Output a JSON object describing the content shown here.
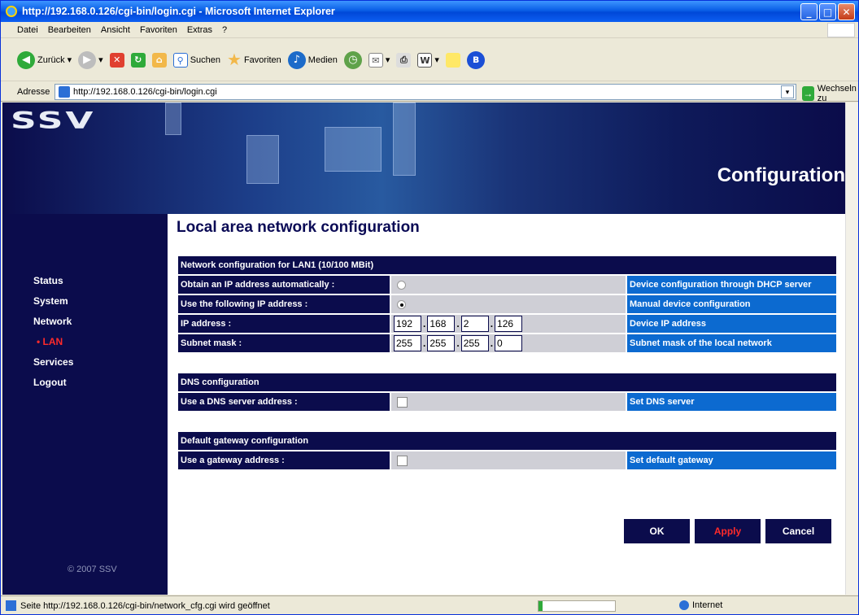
{
  "window": {
    "title": "http://192.168.0.126/cgi-bin/login.cgi - Microsoft Internet Explorer",
    "minimize_icon": "minimize-icon",
    "maximize_icon": "maximize-icon",
    "close_icon": "close-icon"
  },
  "menu": {
    "items": [
      "Datei",
      "Bearbeiten",
      "Ansicht",
      "Favoriten",
      "Extras",
      "?"
    ]
  },
  "toolbar": {
    "back_label": "Zurück",
    "search_label": "Suchen",
    "favorites_label": "Favoriten",
    "media_label": "Medien"
  },
  "address": {
    "label": "Adresse",
    "url": "http://192.168.0.126/cgi-bin/login.cgi",
    "go_label": "Wechseln zu"
  },
  "banner": {
    "logo": "SSV",
    "title": "Configuration"
  },
  "sidebar": {
    "items": [
      "Status",
      "System",
      "Network",
      "• LAN",
      "Services",
      "Logout"
    ],
    "copyright": "© 2007 SSV"
  },
  "main": {
    "heading": "Local area network configuration",
    "lan": {
      "header": "Network configuration for LAN1 (10/100 MBit)",
      "rows": [
        {
          "label": "Obtain an IP address automatically :",
          "desc": "Device configuration through DHCP server"
        },
        {
          "label": "Use the following IP address :",
          "desc": "Manual device configuration"
        },
        {
          "label": "IP address :",
          "desc": "Device IP address"
        },
        {
          "label": "Subnet mask :",
          "desc": "Subnet mask of the local network"
        }
      ],
      "ip": [
        "192",
        "168",
        "2",
        "126"
      ],
      "mask": [
        "255",
        "255",
        "255",
        "0"
      ],
      "ip_separators": [
        ".",
        ".",
        "."
      ],
      "mask_separators": [
        ".",
        ".",
        "."
      ],
      "dhcp_selected": false,
      "static_selected": true
    },
    "dns": {
      "header": "DNS configuration",
      "label": "Use a DNS server address :",
      "desc": "Set DNS server",
      "checked": false
    },
    "gateway": {
      "header": "Default gateway configuration",
      "label": "Use a gateway address :",
      "desc": "Set default gateway",
      "checked": false
    },
    "buttons": {
      "ok": "OK",
      "apply": "Apply",
      "cancel": "Cancel"
    }
  },
  "status": {
    "text": "Seite http://192.168.0.126/cgi-bin/network_cfg.cgi wird geöffnet",
    "zone": "Internet",
    "progress": 0.05
  },
  "colors": {
    "navy": "#0b0c4c",
    "blue": "#0c6ad0",
    "active_red": "#ff2a2a"
  }
}
